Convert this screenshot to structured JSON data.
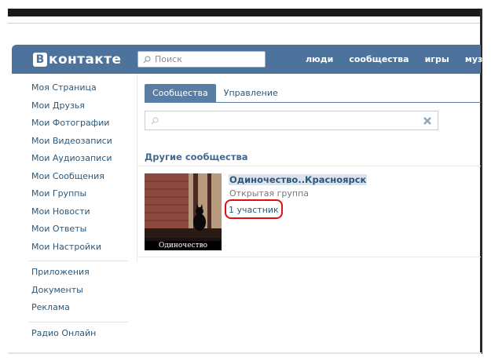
{
  "header": {
    "logo_mark": "B",
    "logo_text": "контакте",
    "search_placeholder": "Поиск",
    "nav": [
      "люди",
      "сообщества",
      "игры",
      "музыка"
    ]
  },
  "sidebar": {
    "items": [
      "Моя Страница",
      "Мои Друзья",
      "Мои Фотографии",
      "Мои Видеозаписи",
      "Мои Аудиозаписи",
      "Мои Сообщения",
      "Мои Группы",
      "Мои Новости",
      "Мои Ответы",
      "Мои Настройки"
    ],
    "extra": [
      "Приложения",
      "Документы",
      "Реклама"
    ],
    "radio": "Радио Онлайн"
  },
  "tabs": {
    "communities": "Сообщества",
    "manage": "Управление"
  },
  "filter": {
    "value": ""
  },
  "section": {
    "title": "Другие сообщества"
  },
  "group": {
    "name": "Одиночество..Красноярск",
    "type": "Открытая группа",
    "members": "1 участник",
    "photo_caption": "Одиночество"
  },
  "colors": {
    "header_bg": "#4d739d",
    "link": "#2b587a",
    "tab_active": "#597da3",
    "highlight": "#e01010"
  }
}
